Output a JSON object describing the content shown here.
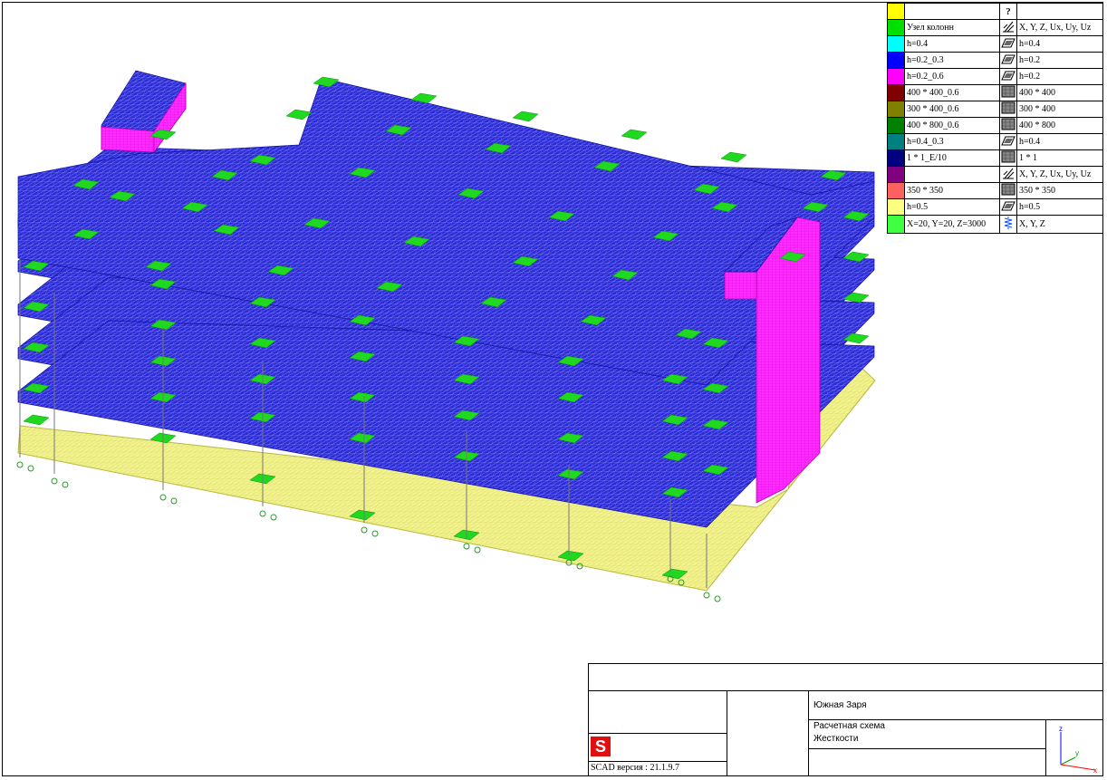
{
  "legend": {
    "header_icon": "?",
    "rows": [
      {
        "color": "#ffff00",
        "label": "",
        "icon": "",
        "desc": ""
      },
      {
        "color": "#00e000",
        "label": "Узел колонн",
        "icon": "fixity-icon",
        "desc": "X, Y, Z, Ux, Uy, Uz"
      },
      {
        "color": "#00ffff",
        "label": "h=0.4",
        "icon": "plate-icon",
        "desc": "h=0.4"
      },
      {
        "color": "#0000ff",
        "label": "h=0.2_0.3",
        "icon": "plate-icon",
        "desc": "h=0.2"
      },
      {
        "color": "#ff00ff",
        "label": "h=0.2_0.6",
        "icon": "plate-icon",
        "desc": "h=0.2"
      },
      {
        "color": "#800000",
        "label": "400 * 400_0.6",
        "icon": "section-icon",
        "desc": "400 * 400"
      },
      {
        "color": "#808000",
        "label": "300 * 400_0.6",
        "icon": "section-icon",
        "desc": "300 * 400"
      },
      {
        "color": "#008000",
        "label": "400 * 800_0.6",
        "icon": "section-icon",
        "desc": "400 * 800"
      },
      {
        "color": "#008080",
        "label": "h=0.4_0.3",
        "icon": "plate-icon",
        "desc": "h=0.4"
      },
      {
        "color": "#000080",
        "label": "1 * 1_E/10",
        "icon": "section-icon",
        "desc": "1 * 1"
      },
      {
        "color": "#800080",
        "label": "",
        "icon": "fixity-icon",
        "desc": "X, Y, Z, Ux, Uy, Uz"
      },
      {
        "color": "#ff6060",
        "label": "350 * 350",
        "icon": "section-icon",
        "desc": "350 * 350"
      },
      {
        "color": "#ffff80",
        "label": "h=0.5",
        "icon": "plate-icon",
        "desc": "h=0.5"
      },
      {
        "color": "#40ff40",
        "label": "X=20, Y=20, Z=3000",
        "icon": "spring-icon",
        "desc": "X, Y, Z"
      }
    ]
  },
  "title_block": {
    "project": "Южная Заря",
    "sheet_title": "Расчетная схема",
    "sheet_subtitle": "Жесткости",
    "version": "SCAD версия : 21.1.9.7",
    "logo_letter": "S"
  },
  "axes": {
    "z": "z",
    "y": "y",
    "x": "x"
  },
  "colors": {
    "slab": "#2a2ad8",
    "mesh": "#8f8ff5",
    "wall": "#ff2cff",
    "green": "#1fd81f",
    "foundation": "#f2f28a",
    "foundation_mesh": "#d4d460",
    "logo": "#e01010"
  }
}
